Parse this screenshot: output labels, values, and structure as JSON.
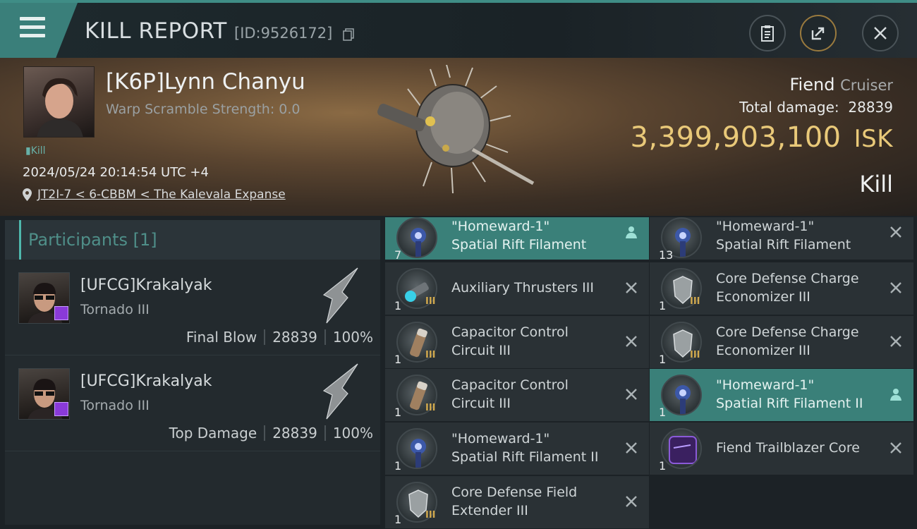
{
  "header": {
    "title": "KILL REPORT",
    "kill_id": "[ID:9526172]"
  },
  "victim": {
    "name": "[K6P]Lynn Chanyu",
    "warp_scramble": "Warp Scramble Strength: 0.0",
    "tag": "Kill",
    "time": "2024/05/24 20:14:54 UTC +4",
    "location": "JT2I-7 < 6-CBBM < The Kalevala Expanse",
    "ship_name": "Fiend",
    "ship_class": "Cruiser",
    "total_damage_label": "Total damage:",
    "total_damage": "28839",
    "isk_value": "3,399,903,100",
    "isk_unit": "ISK",
    "result": "Kill"
  },
  "participants": {
    "title": "Participants",
    "count": "[1]",
    "rows": [
      {
        "name": "[UFCG]Krakalyak",
        "ship": "Tornado III",
        "label": "Final Blow",
        "damage": "28839",
        "percent": "100%"
      },
      {
        "name": "[UFCG]Krakalyak",
        "ship": "Tornado III",
        "label": "Top Damage",
        "damage": "28839",
        "percent": "100%"
      }
    ]
  },
  "items": [
    {
      "name1": "\"Homeward-1\"",
      "name2": "Spatial Rift Filament",
      "qty": "7",
      "tier": "",
      "status": "person",
      "icon": "filament-icon"
    },
    {
      "name1": "\"Homeward-1\"",
      "name2": "Spatial Rift Filament",
      "qty": "13",
      "tier": "",
      "status": "x",
      "icon": "filament-icon"
    },
    {
      "name1": "Auxiliary Thrusters III",
      "name2": "",
      "qty": "1",
      "tier": "III",
      "status": "x",
      "icon": "thruster-icon"
    },
    {
      "name1": "Core Defense Charge",
      "name2": "Economizer III",
      "qty": "1",
      "tier": "III",
      "status": "x",
      "icon": "shield-module-icon"
    },
    {
      "name1": "Capacitor Control",
      "name2": "Circuit III",
      "qty": "1",
      "tier": "III",
      "status": "x",
      "icon": "capacitor-icon"
    },
    {
      "name1": "Core Defense Charge",
      "name2": "Economizer III",
      "qty": "1",
      "tier": "III",
      "status": "x",
      "icon": "shield-module-icon"
    },
    {
      "name1": "Capacitor Control",
      "name2": "Circuit III",
      "qty": "1",
      "tier": "III",
      "status": "x",
      "icon": "capacitor-icon"
    },
    {
      "name1": "\"Homeward-1\"",
      "name2": "Spatial Rift Filament II",
      "qty": "1",
      "tier": "",
      "status": "person",
      "icon": "filament-icon"
    },
    {
      "name1": "\"Homeward-1\"",
      "name2": "Spatial Rift Filament II",
      "qty": "1",
      "tier": "",
      "status": "x",
      "icon": "filament-icon"
    },
    {
      "name1": "Fiend Trailblazer Core",
      "name2": "",
      "qty": "1",
      "tier": "",
      "status": "x",
      "icon": "core-icon"
    },
    {
      "name1": "Core Defense Field",
      "name2": "Extender III",
      "qty": "1",
      "tier": "III",
      "status": "x",
      "icon": "shield-module-icon"
    }
  ]
}
